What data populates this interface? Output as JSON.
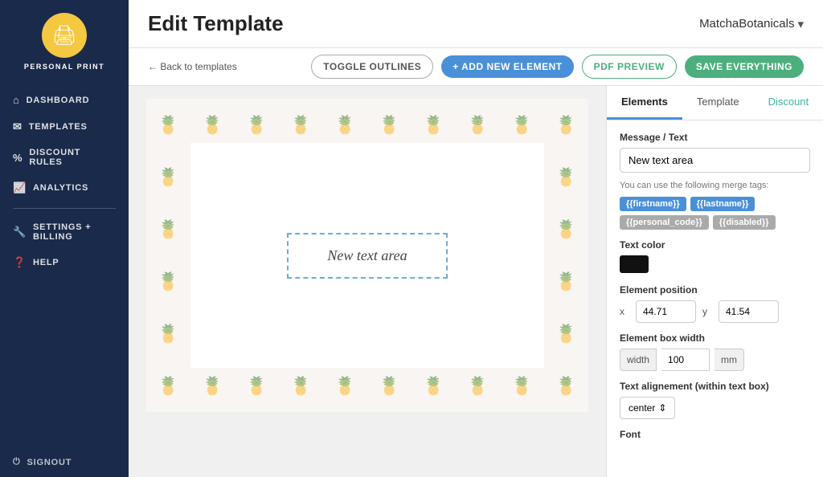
{
  "sidebar": {
    "brand": "PERSONAL PRINT",
    "logo_icon": "🖨",
    "nav_items": [
      {
        "id": "dashboard",
        "label": "DASHBOARD",
        "icon": "⌂"
      },
      {
        "id": "templates",
        "label": "TEMPLATES",
        "icon": "✉"
      },
      {
        "id": "discount-rules",
        "label": "DISCOUNT RULES",
        "icon": "%"
      },
      {
        "id": "analytics",
        "label": "ANALYTICS",
        "icon": "📈"
      },
      {
        "id": "settings-billing",
        "label": "SETTINGS + BILLING",
        "icon": "🔧"
      },
      {
        "id": "help",
        "label": "HELP",
        "icon": "❓"
      }
    ],
    "signout_label": "SIGNOUT"
  },
  "header": {
    "title": "Edit Template",
    "brand_name": "MatchaBotanicals",
    "chevron": "▾"
  },
  "toolbar": {
    "back_label": "← Back to templates",
    "toggle_outlines_label": "TOGGLE OUTLINES",
    "add_element_label": "+ ADD NEW ELEMENT",
    "pdf_preview_label": "PDF PREVIEW",
    "save_everything_label": "SAVE EVERYTHING"
  },
  "canvas": {
    "text_content": "New text area"
  },
  "right_panel": {
    "tabs": [
      {
        "id": "elements",
        "label": "Elements",
        "active": true
      },
      {
        "id": "template",
        "label": "Template",
        "active": false
      },
      {
        "id": "discount",
        "label": "Discount",
        "active": false
      }
    ],
    "message_label": "Message / Text",
    "message_value": "New text area",
    "hint_text": "You can use the following merge tags:",
    "merge_tags": [
      {
        "id": "firstname",
        "label": "{{firstname}}",
        "style": "blue"
      },
      {
        "id": "lastname",
        "label": "{{lastname}}",
        "style": "blue"
      },
      {
        "id": "personal_code",
        "label": "{{personal_code}}",
        "style": "gray"
      },
      {
        "id": "disabled",
        "label": "{{disabled}}",
        "style": "gray"
      }
    ],
    "text_color_label": "Text color",
    "element_position_label": "Element position",
    "x_label": "x",
    "x_value": "44.71",
    "y_label": "y",
    "y_value": "41.54",
    "element_box_width_label": "Element box width",
    "width_label": "width",
    "width_value": "100",
    "width_unit": "mm",
    "text_alignment_label": "Text alignement (within text box)",
    "alignment_value": "center",
    "font_label": "Font"
  }
}
